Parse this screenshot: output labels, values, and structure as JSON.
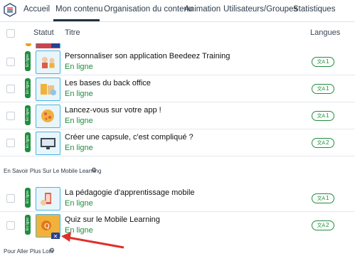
{
  "nav": {
    "items": [
      "Accueil",
      "Mon contenu",
      "Organisation du contenu",
      "Animation",
      "Utilisateurs/Groupes",
      "Statistiques"
    ],
    "active": "Mon contenu"
  },
  "table": {
    "headers": {
      "statut": "Statut",
      "titre": "Titre",
      "langues": "Langues"
    }
  },
  "rows": [
    {
      "status_pill": "En ligne",
      "title": "Personnaliser son application Beedeez Training",
      "status": "En ligne",
      "lang_count": "1",
      "thumb_icon": "people-icon"
    },
    {
      "status_pill": "En ligne",
      "title": "Les bases du back office",
      "status": "En ligne",
      "lang_count": "1",
      "thumb_icon": "books-icon"
    },
    {
      "status_pill": "En ligne",
      "title": "Lancez-vous sur votre app !",
      "status": "En ligne",
      "lang_count": "1",
      "thumb_icon": "globe-icon"
    },
    {
      "status_pill": "En ligne",
      "title": "Créer une capsule, c'est compliqué ?",
      "status": "En ligne",
      "lang_count": "2",
      "thumb_icon": "monitor-icon"
    }
  ],
  "section1": {
    "label": "En Savoir Plus Sur Le Mobile Learning"
  },
  "rows2": [
    {
      "status_pill": "En ligne",
      "title": "La pédagogie d'apprentissage mobile",
      "status": "En ligne",
      "lang_count": "1",
      "thumb_icon": "hand-phone-icon"
    },
    {
      "status_pill": "En ligne",
      "title": "Quiz sur le Mobile Learning",
      "status": "En ligne",
      "lang_count": "2",
      "thumb_icon": "quiz-icon"
    }
  ],
  "section2": {
    "label": "Pour Aller Plus Loin"
  },
  "colors": {
    "green": "#1e8e3e",
    "blue_border": "#4ab3df",
    "arrow_red": "#e0302a"
  }
}
